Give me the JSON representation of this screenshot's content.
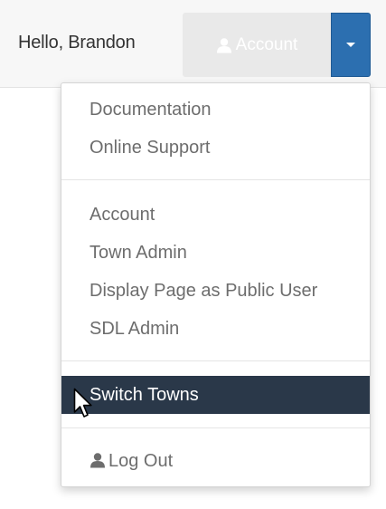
{
  "header": {
    "greeting": "Hello, Brandon",
    "account_label": "Account",
    "account_icon": "user-icon",
    "toggle_icon": "caret-down-icon",
    "accent_color": "#2c6fb0"
  },
  "menu": {
    "help_items": [
      {
        "label": "Documentation"
      },
      {
        "label": "Online Support"
      }
    ],
    "admin_items": [
      {
        "label": "Account"
      },
      {
        "label": "Town Admin"
      },
      {
        "label": "Display Page as Public User"
      },
      {
        "label": "SDL Admin"
      }
    ],
    "switch_item": {
      "label": "Switch Towns",
      "highlight_color": "#2a3849"
    },
    "logout_item": {
      "label": "Log Out",
      "icon": "user-icon"
    }
  }
}
